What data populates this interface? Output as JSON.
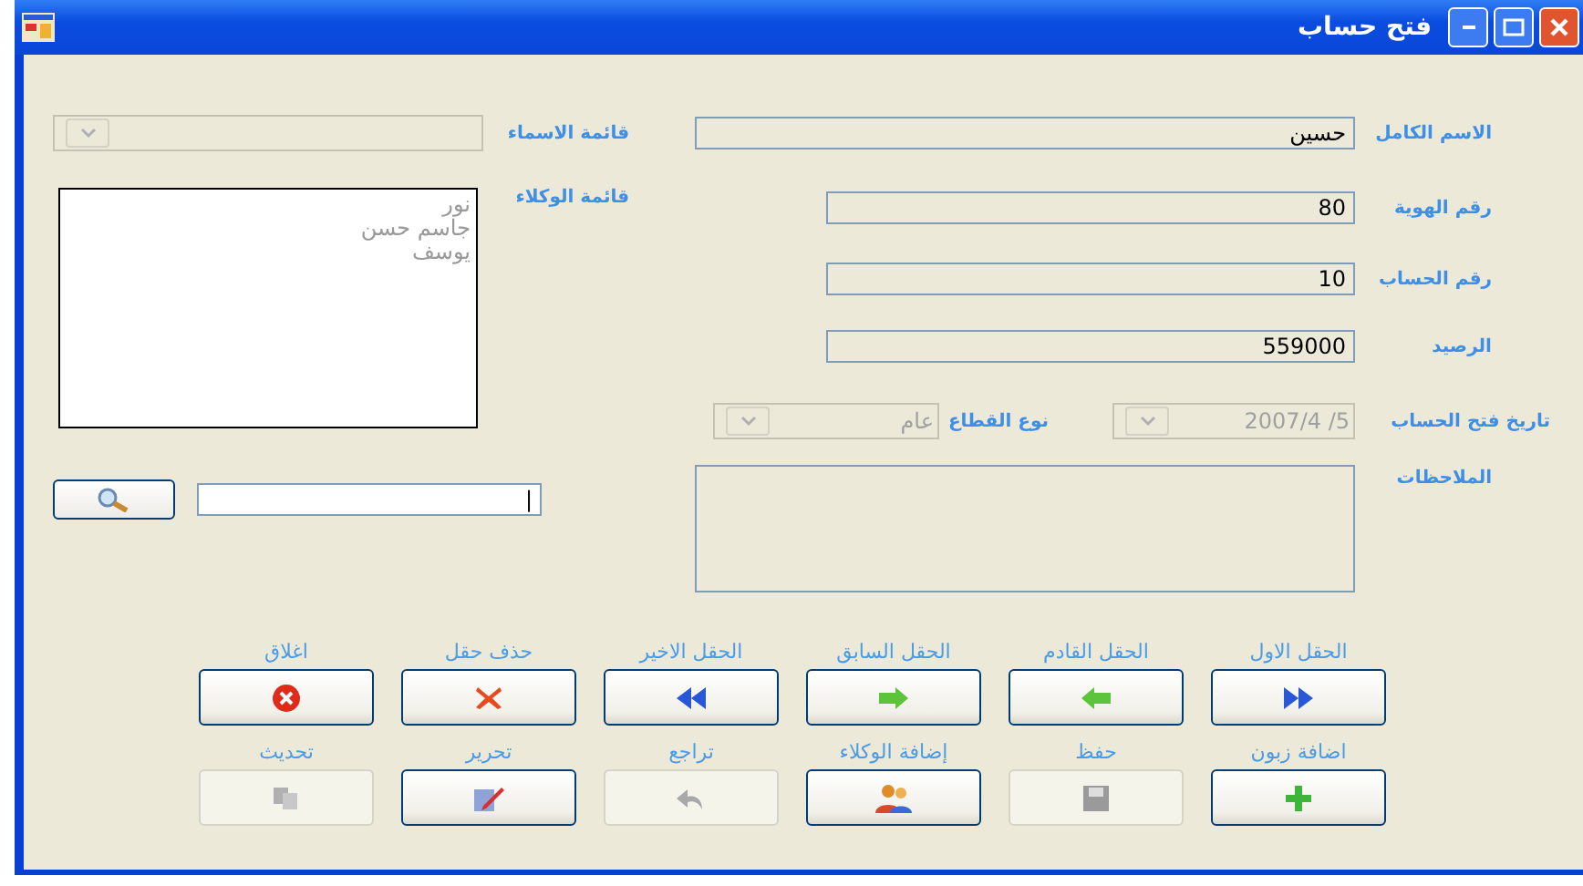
{
  "window": {
    "title": "فتح حساب"
  },
  "fields": [
    {
      "label": "الاسم الكامل",
      "value": "حسين",
      "kind": "wide"
    },
    {
      "label": "رقم الهوية",
      "value": "80",
      "kind": "short"
    },
    {
      "label": "رقم الحساب",
      "value": "10",
      "kind": "short"
    },
    {
      "label": "الرصيد",
      "value": "559000",
      "kind": "short"
    }
  ],
  "account_date": {
    "label": "تاريخ فتح الحساب",
    "value": "5/  2007/4",
    "disabled": true
  },
  "sector": {
    "label": "نوع القطاع",
    "value": "عام",
    "disabled": true
  },
  "notes": {
    "label": "الملاحظات"
  },
  "names_list": {
    "label": "قائمة الاسماء",
    "disabled": true
  },
  "agents_list": {
    "label": "قائمة الوكلاء",
    "items": [
      "نور",
      "جاسم حسن",
      "يوسف"
    ]
  },
  "search": {
    "value": "|"
  },
  "buttons": [
    {
      "label": "الحقل الاول",
      "kind": "first",
      "disabled": false
    },
    {
      "label": "الحقل القادم",
      "kind": "next",
      "disabled": false
    },
    {
      "label": "الحقل السابق",
      "kind": "prev",
      "disabled": false
    },
    {
      "label": "الحقل الاخير",
      "kind": "last",
      "disabled": false
    },
    {
      "label": "حذف حقل",
      "kind": "delete",
      "disabled": false
    },
    {
      "label": "اغلاق",
      "kind": "close",
      "disabled": false
    },
    {
      "label": "اضافة زبون",
      "kind": "add",
      "disabled": false
    },
    {
      "label": "حفظ",
      "kind": "save",
      "disabled": true
    },
    {
      "label": "إضافة الوكلاء",
      "kind": "people",
      "disabled": false
    },
    {
      "label": "تراجع",
      "kind": "undo",
      "disabled": true
    },
    {
      "label": "تحرير",
      "kind": "edit",
      "disabled": false
    },
    {
      "label": "تحديث",
      "kind": "refresh",
      "disabled": true
    }
  ]
}
